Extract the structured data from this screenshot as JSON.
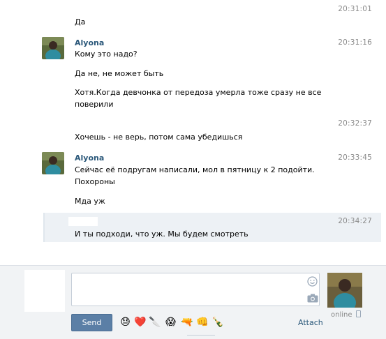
{
  "messages": [
    {
      "time": "20:31:01",
      "text": "Да"
    },
    {
      "author": "Alyona",
      "time": "20:31:16",
      "lines": [
        "Кому это надо?",
        "Да не, не может быть",
        "Хотя.Когда девчонка от передоза умерла тоже сразу не все",
        "поверили"
      ]
    },
    {
      "time": "20:32:37",
      "text": "Хочешь - не верь, потом сама убедишься"
    },
    {
      "author": "Alyona",
      "time": "20:33:45",
      "lines": [
        "Сейчас её подругам написали, мол в пятницу к 2 подойти.",
        "Похороны",
        "Мда уж"
      ]
    },
    {
      "time": "20:34:27",
      "text": "И ты подходи, что уж. Мы будем смотреть"
    }
  ],
  "composer": {
    "send_label": "Send",
    "attach_label": "Attach",
    "status": "online"
  },
  "emojis": [
    "😓",
    "❤️",
    "🔪",
    "😱",
    "🔫",
    "👊",
    "🍾"
  ],
  "colors": {
    "accent": "#5b7fa6",
    "link": "#2b587a",
    "selected_bg": "#edf1f5"
  }
}
